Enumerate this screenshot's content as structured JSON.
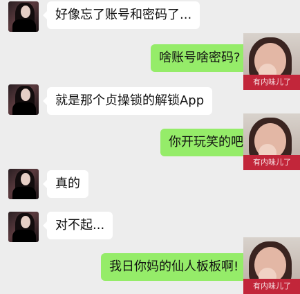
{
  "chat": {
    "messages": [
      {
        "side": "in",
        "text": "好像忘了账号和密码了..."
      },
      {
        "side": "out",
        "text": "啥账号啥密码?"
      },
      {
        "side": "in",
        "text": "就是那个贞操锁的解锁App"
      },
      {
        "side": "out",
        "text": "你开玩笑的吧"
      },
      {
        "side": "in",
        "text": "真的"
      },
      {
        "side": "in",
        "text": "对不起..."
      },
      {
        "side": "out",
        "text": "我日你妈的仙人板板啊!"
      }
    ],
    "avatar_watermark": "有内味儿了"
  },
  "colors": {
    "background": "#ededed",
    "incoming_bubble": "#ffffff",
    "outgoing_bubble": "#95ec69"
  }
}
